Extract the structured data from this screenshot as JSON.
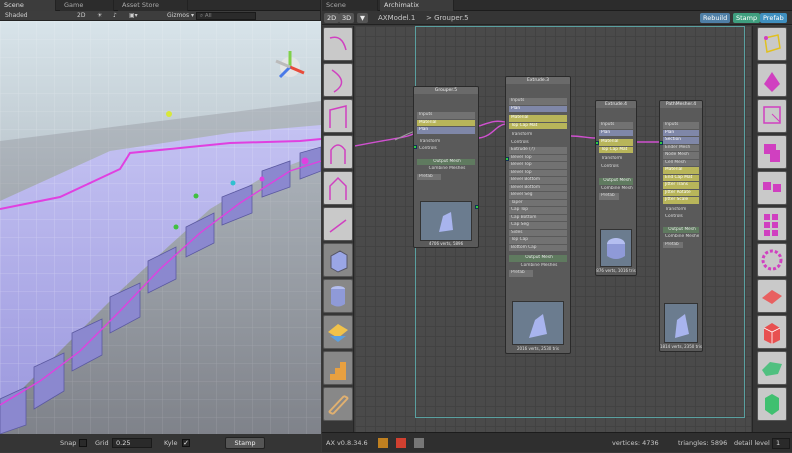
{
  "scene": {
    "tabs": [
      {
        "label": "Scene"
      },
      {
        "label": "Game"
      },
      {
        "label": "Asset Store"
      }
    ],
    "toolbar": {
      "shading": "Shaded",
      "mode_2d": "2D",
      "gizmos": "Gizmos",
      "search_all": "All"
    },
    "footer": {
      "snap_label": "Snap",
      "grid_label": "Grid",
      "grid_value": "0.25",
      "kyle_label": "Kyle",
      "stamp_label": "Stamp"
    }
  },
  "archimatix": {
    "tabs": [
      {
        "label": "Scene"
      },
      {
        "label": "Archimatix"
      }
    ],
    "toolbar": {
      "btn_2d": "2D",
      "btn_3d": "3D",
      "model_name": "AXModel.1",
      "breadcrumb": "> Grouper.5",
      "rebuild": "Rebuild",
      "stamp": "Stamp",
      "prefab": "Prefab"
    },
    "nodes": {
      "grouper": {
        "title": "Grouper.5",
        "rows": [
          "Inputs",
          "Material",
          "Plan",
          "Transform",
          "Controls"
        ],
        "output": "Output Mesh",
        "footer_btns": [
          "Combine Meshes",
          "Prefab"
        ],
        "caption": "4706 verts, 5896"
      },
      "extrude": {
        "title": "Extrude.3",
        "rows": [
          "Inputs",
          "Plan",
          "Material",
          "Top Cap Mat",
          "Transform",
          "Controls",
          "Extrude (?)",
          "Bevel Top",
          "Bevel Top",
          "Bevel Top",
          "Bevel Bottom",
          "Bevel Bottom",
          "Bevel Seg",
          "Taper",
          "Cap Top",
          "Cap Bottom",
          "Cap Seg",
          "Sides",
          "Top Cap",
          "Bottom Cap"
        ],
        "output": "Output Mesh",
        "footer_btns": [
          "Combine Meshes",
          "Prefab"
        ],
        "caption": "2016 verts, 2530 tris"
      },
      "extrude2": {
        "title": "Extrude.4",
        "rows": [
          "Inputs",
          "Plan",
          "Material",
          "Top Cap Mat",
          "Transform",
          "Controls"
        ],
        "output": "Output Mesh",
        "footer_btns": [
          "Combine Meshes",
          "Prefab"
        ],
        "caption": "876 verts, 1016 tris"
      },
      "pathmesher": {
        "title": "PathMesher.4",
        "rows": [
          "Inputs",
          "Plan",
          "Section",
          "Ender Mesh",
          "Node Mesh",
          "Cell Mesh",
          "Material",
          "End Cap Mat",
          "Jitter Trans",
          "Jitter Rotate",
          "Jitter Scale",
          "Transform",
          "Controls"
        ],
        "output": "Output Mesh",
        "footer_btns": [
          "Combine Meshes",
          "Prefab"
        ],
        "caption": "1814 verts, 2350 tris"
      }
    },
    "footer": {
      "version": "AX v0.8.34.6",
      "vertices_label": "vertices: 4736",
      "triangles_label": "triangles: 5896",
      "detail_label": "detail level",
      "detail_value": "1"
    },
    "left_palette_icons": [
      "arc-icon",
      "curve-icon",
      "polygon-icon",
      "arch-icon",
      "gable-icon",
      "line-icon",
      "box-mesh-icon",
      "cylinder-mesh-icon",
      "tile-mesh-icon",
      "stairs-mesh-icon",
      "fence-mesh-icon"
    ],
    "right_palette_icons": [
      "grouper-icon",
      "repeater-icon",
      "shape-offset-icon",
      "shape-merge-icon",
      "shape-combine-icon",
      "grid-repeater-icon",
      "radial-repeater-icon",
      "plane-icon",
      "cube-icon",
      "lofted-icon",
      "extruded-icon"
    ]
  },
  "colors": {
    "accent_magenta": "#e040e0",
    "node_plan": "#7f87a8",
    "node_material": "#b8b55a",
    "socket": "#2ecc40",
    "rebuild_btn": "#4f7fa6",
    "stamp_btn": "#3f9f7f"
  }
}
